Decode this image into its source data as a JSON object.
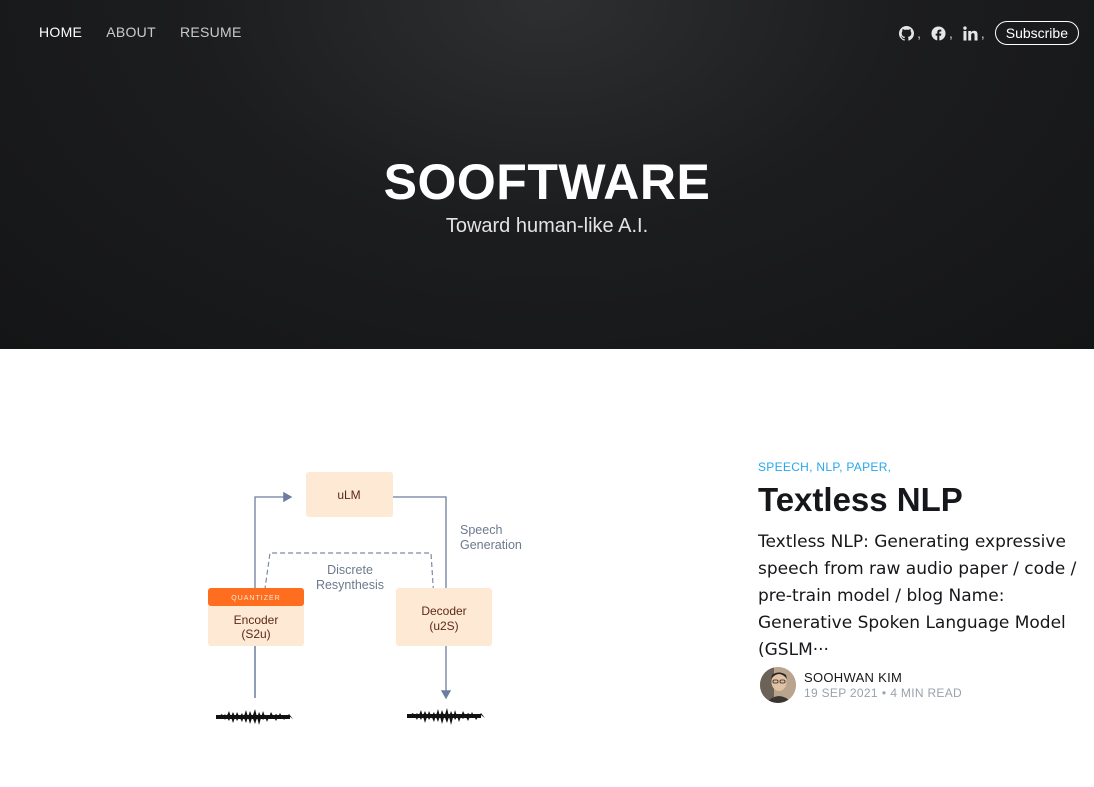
{
  "nav": {
    "items": [
      {
        "label": "HOME",
        "active": true
      },
      {
        "label": "ABOUT",
        "active": false
      },
      {
        "label": "RESUME",
        "active": false
      }
    ]
  },
  "social": {
    "icons": [
      "github-icon",
      "facebook-icon",
      "linkedin-icon"
    ],
    "separator": ",",
    "subscribe_label": "Subscribe"
  },
  "hero": {
    "title": "SOOFTWARE",
    "description": "Toward human-like A.I."
  },
  "post": {
    "tags": "SPEECH, NLP, PAPER,",
    "title": "Textless NLP",
    "excerpt": "Textless NLP: Generating expressive speech from raw audio paper / code / pre-train model / blog Name: Generative Spoken Language Model (GSLM···",
    "author": "SOOHWAN KIM",
    "date": "19 SEP 2021",
    "bullet": "•",
    "read_time": "4 MIN READ"
  },
  "diagram": {
    "ulm": "uLM",
    "speech_generation": [
      "Speech",
      "Generation"
    ],
    "discrete_resynthesis": [
      "Discrete",
      "Resynthesis"
    ],
    "quantizer": "QUANTIZER",
    "encoder": [
      "Encoder",
      "(S2u)"
    ],
    "decoder": [
      "Decoder",
      "(u2S)"
    ]
  },
  "colors": {
    "accent": "#26a8ed",
    "box_fill": "#fde9d4",
    "quantizer": "#ff6d1f",
    "arrow": "#6c7ea0"
  }
}
